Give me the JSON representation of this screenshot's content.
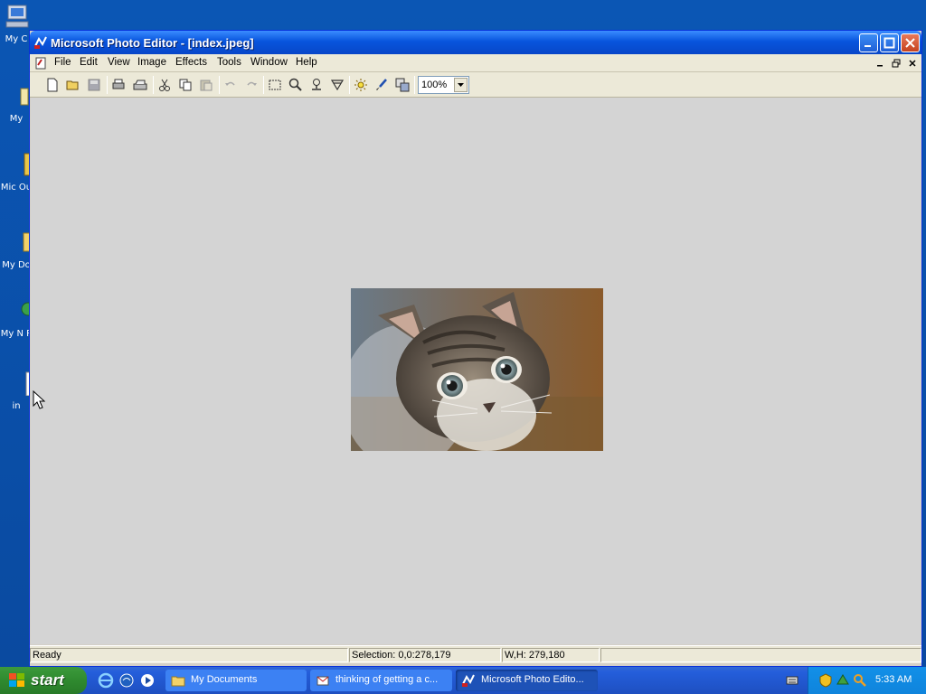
{
  "desktop": {
    "icons": [
      {
        "label": "My C",
        "icon": "my-computer-icon"
      },
      {
        "label": "My",
        "icon": "my-documents-icon"
      },
      {
        "label": "Mic Ou",
        "icon": "outlook-icon"
      },
      {
        "label": "My Do",
        "icon": "folder-icon"
      },
      {
        "label": "My N P",
        "icon": "network-places-icon"
      },
      {
        "label": "in",
        "icon": "file-icon"
      }
    ]
  },
  "window": {
    "title": "Microsoft Photo Editor - [index.jpeg]",
    "menu": [
      "File",
      "Edit",
      "View",
      "Image",
      "Effects",
      "Tools",
      "Window",
      "Help"
    ],
    "zoom": "100%",
    "status": {
      "ready": "Ready",
      "selection": "Selection: 0,0:278,179",
      "dimensions": "W,H: 279,180"
    },
    "image": {
      "subject": "kitten"
    }
  },
  "taskbar": {
    "start_label": "start",
    "tasks": [
      {
        "label": "My Documents",
        "icon": "folder-icon"
      },
      {
        "label": "thinking of getting a c...",
        "icon": "outlook-express-icon"
      },
      {
        "label": "Microsoft Photo Edito...",
        "icon": "photo-editor-icon"
      }
    ],
    "clock": "5:33 AM"
  },
  "colors": {
    "desktop_blue": "#0b56b4",
    "title_blue": "#0855dd",
    "start_green": "#2f8a2f",
    "canvas_gray": "#d4d4d4"
  }
}
